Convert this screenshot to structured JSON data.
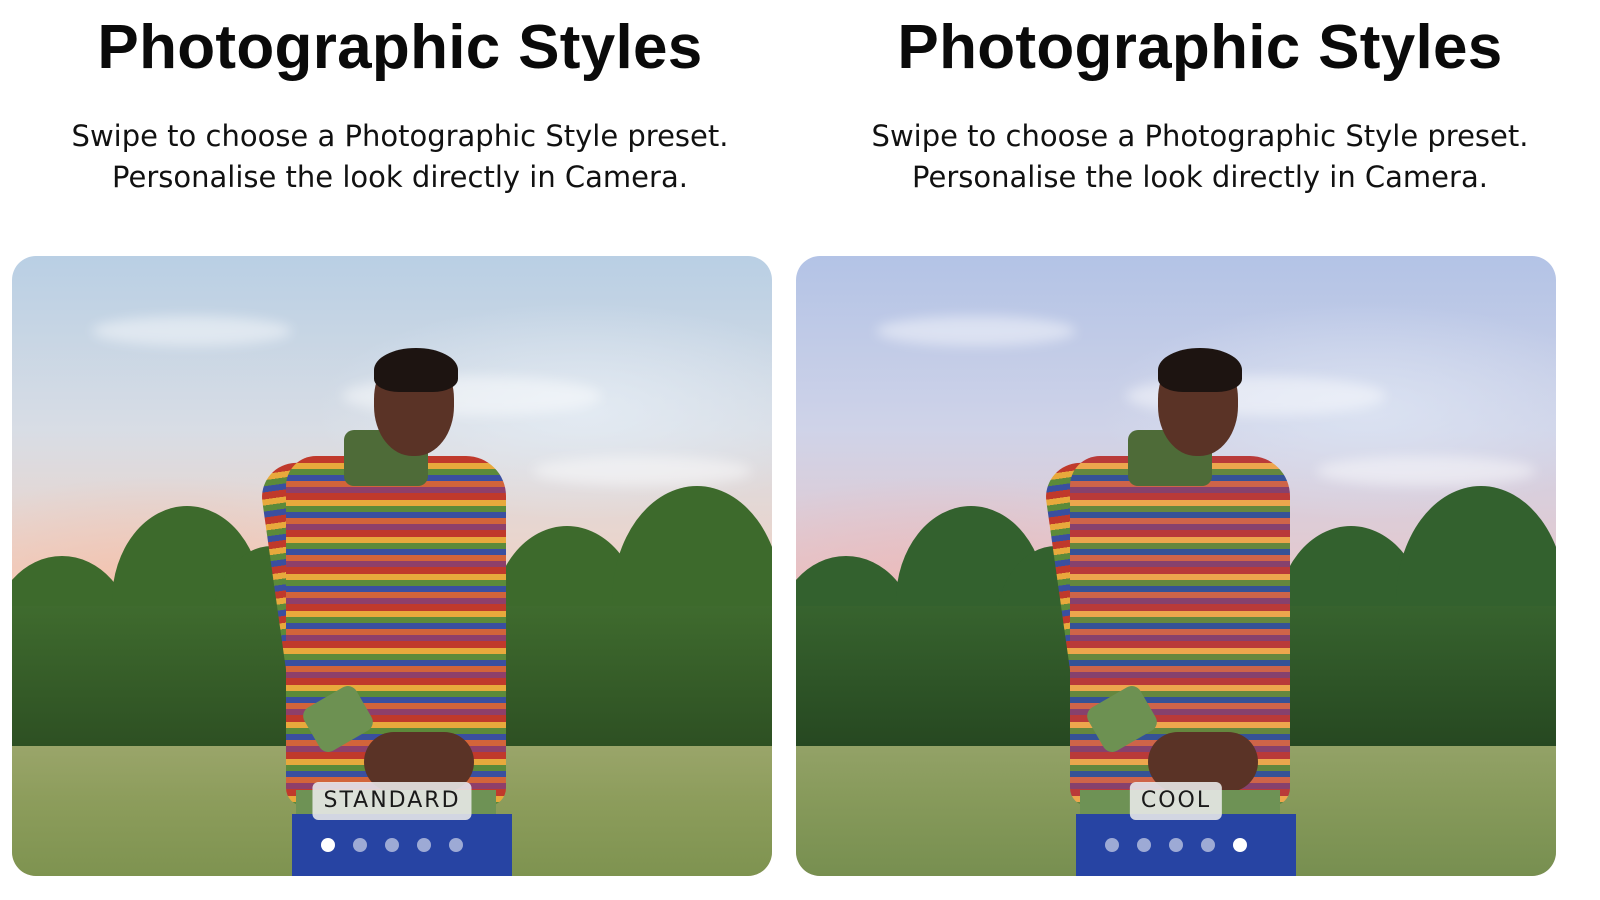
{
  "panels": [
    {
      "title": "Photographic Styles",
      "subtitle_line1": "Swipe to choose a Photographic Style preset.",
      "subtitle_line2": "Personalise the look directly in Camera.",
      "style_label": "STANDARD",
      "page_count": 5,
      "active_page": 1
    },
    {
      "title": "Photographic Styles",
      "subtitle_line1": "Swipe to choose a Photographic Style preset.",
      "subtitle_line2": "Personalise the look directly in Camera.",
      "style_label": "COOL",
      "page_count": 5,
      "active_page": 5
    }
  ]
}
